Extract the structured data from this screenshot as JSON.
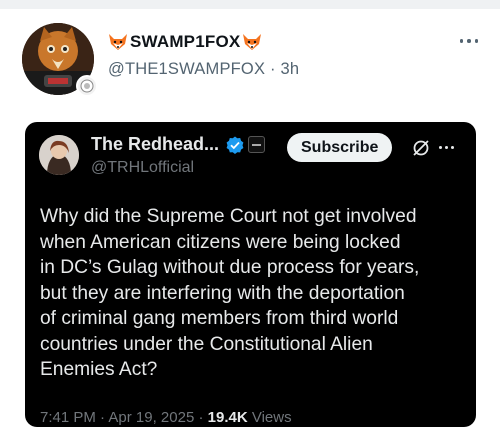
{
  "post": {
    "display_name": "SWAMP1FOX",
    "name_emoji": "fox-face-icon",
    "handle": "@THE1SWAMPFOX",
    "separator": "·",
    "time": "3h"
  },
  "embedded_post": {
    "display_name": "The Redhead...",
    "handle": "@TRHLofficial",
    "subscribe_label": "Subscribe",
    "text_lines": [
      "Why did the Supreme Court not get involved",
      "when American citizens were being locked",
      "in DC’s Gulag without due process for years,",
      "but they are interfering with the deportation",
      "of criminal gang members from third world",
      "countries under the Constitutional Alien",
      "Enemies Act?"
    ],
    "meta": {
      "time": "7:41 PM",
      "sep1": "·",
      "date": "Apr 19, 2025",
      "sep2": "·",
      "views_count": "19.4K",
      "views_label": "Views"
    }
  },
  "colors": {
    "secondary_text": "#536471",
    "verified_blue": "#1d9bf0",
    "embed_bg": "#000000",
    "fox_orange": "#f4731f"
  }
}
